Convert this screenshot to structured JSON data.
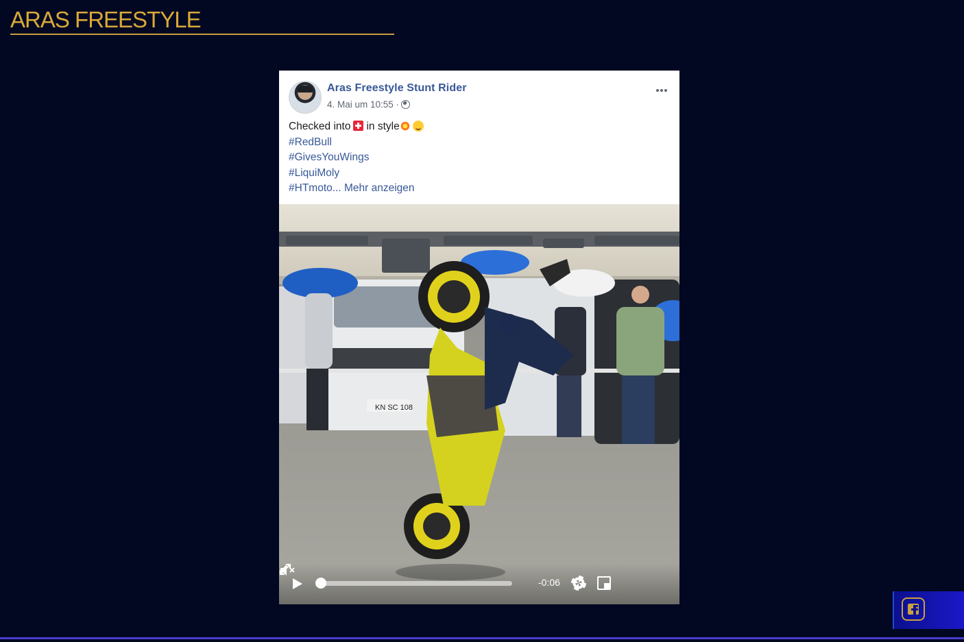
{
  "page": {
    "title": "ARAS FREESTYLE"
  },
  "post": {
    "author": "Aras Freestyle Stunt Rider",
    "timestamp": "4. Mai um 10:55 ·",
    "text_prefix": "Checked into",
    "text_middle": "in style",
    "hashtags": [
      "#RedBull",
      "#GivesYouWings",
      "#LiquiMoly"
    ],
    "last_hashtag": "#HTmoto...",
    "more_link": "Mehr anzeigen"
  },
  "video": {
    "time_remaining": "-0:06",
    "progress_fraction": 0.02,
    "license_plate": "KN SC 108"
  },
  "social": {
    "network": "facebook"
  },
  "colors": {
    "background": "#020822",
    "title": "#d9a939",
    "link": "#385898",
    "social_panel": "#0b0f8e"
  }
}
